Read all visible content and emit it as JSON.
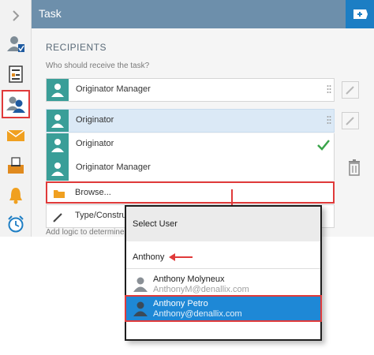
{
  "header": {
    "title": "Task",
    "accent_color": "#6d8fab",
    "add_button_icon": "plus-icon"
  },
  "sidebar": {
    "items": [
      {
        "icon": "chevron-right-icon"
      },
      {
        "icon": "user-check-icon"
      },
      {
        "icon": "form-icon"
      },
      {
        "icon": "recipients-icon",
        "selected": true
      },
      {
        "icon": "envelope-icon"
      },
      {
        "icon": "ballot-box-icon"
      },
      {
        "icon": "bell-icon"
      },
      {
        "icon": "alarm-clock-icon"
      }
    ]
  },
  "recipients": {
    "title": "RECIPIENTS",
    "subtitle": "Who should receive the task?",
    "rows": [
      {
        "label": "Originator Manager"
      },
      {
        "label": "Originator"
      }
    ],
    "dropdown": [
      {
        "label": "Originator"
      },
      {
        "label": "Originator Manager"
      },
      {
        "label": "Browse..."
      },
      {
        "label": "Type/Construct"
      }
    ],
    "logic_text": "Add logic to determine"
  },
  "popup": {
    "title": "Select User",
    "search_value": "Anthony",
    "users": [
      {
        "name": "Anthony Molyneux",
        "email": "AnthonyM@denallix.com"
      },
      {
        "name": "Anthony Petro",
        "email": "Anthony@denallix.com",
        "selected": true
      }
    ]
  },
  "colors": {
    "highlight_red": "#e03a3a",
    "selected_blue": "#1e88d6",
    "check_green": "#3aa44a",
    "avatar_teal": "#3a9e98"
  }
}
